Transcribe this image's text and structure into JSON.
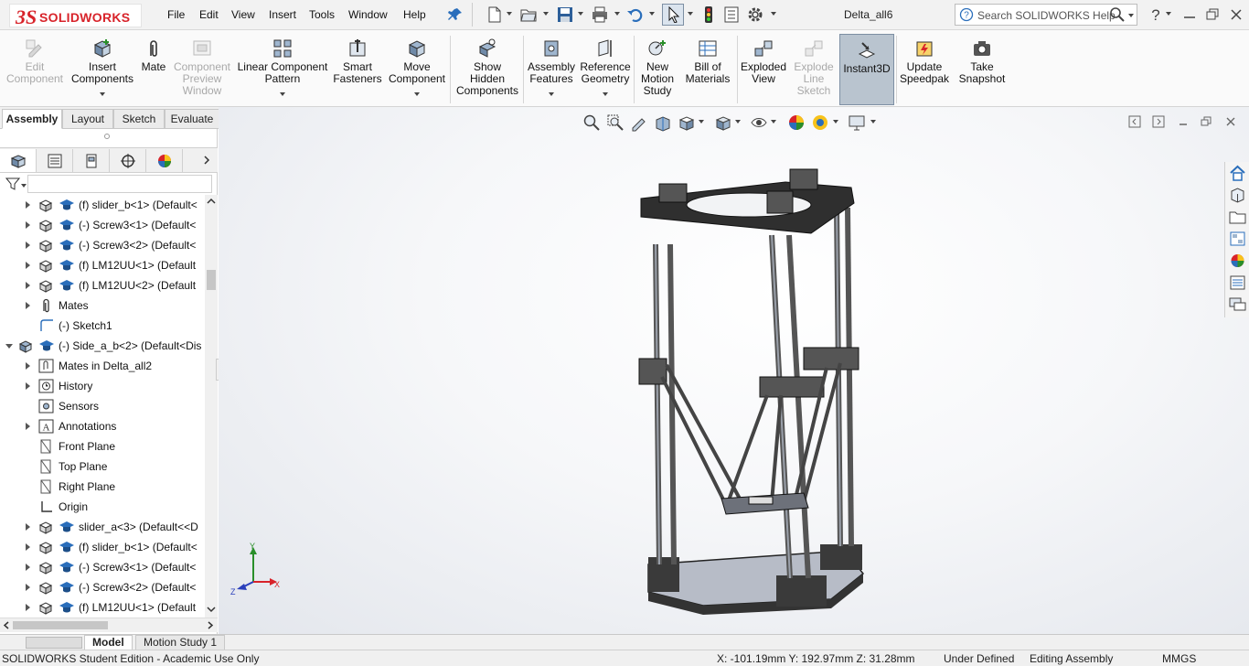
{
  "app": {
    "brand_ds": "3S",
    "brand_name": "SOLIDWORKS",
    "document_title": "Delta_all6"
  },
  "menu": [
    "File",
    "Edit",
    "View",
    "Insert",
    "Tools",
    "Window",
    "Help"
  ],
  "search": {
    "placeholder": "Search SOLIDWORKS Help"
  },
  "commands": [
    {
      "label": "Edit\nComponent",
      "enabled": false,
      "icon": "edit-component-icon"
    },
    {
      "label": "Insert\nComponents",
      "enabled": true,
      "icon": "insert-components-icon"
    },
    {
      "label": "Mate",
      "enabled": true,
      "icon": "mate-icon"
    },
    {
      "label": "Component\nPreview\nWindow",
      "enabled": false,
      "icon": "component-preview-icon"
    },
    {
      "label": "Linear Component\nPattern",
      "enabled": true,
      "icon": "linear-pattern-icon"
    },
    {
      "label": "Smart\nFasteners",
      "enabled": true,
      "icon": "smart-fasteners-icon"
    },
    {
      "label": "Move\nComponent",
      "enabled": true,
      "icon": "move-component-icon"
    },
    {
      "label": "Show\nHidden\nComponents",
      "enabled": true,
      "icon": "show-hidden-icon"
    },
    {
      "label": "Assembly\nFeatures",
      "enabled": true,
      "icon": "assembly-features-icon"
    },
    {
      "label": "Reference\nGeometry",
      "enabled": true,
      "icon": "reference-geometry-icon"
    },
    {
      "label": "New\nMotion\nStudy",
      "enabled": true,
      "icon": "motion-study-icon"
    },
    {
      "label": "Bill of\nMaterials",
      "enabled": true,
      "icon": "bill-of-materials-icon"
    },
    {
      "label": "Exploded\nView",
      "enabled": true,
      "icon": "exploded-view-icon"
    },
    {
      "label": "Explode\nLine\nSketch",
      "enabled": false,
      "icon": "explode-line-icon"
    },
    {
      "label": "Instant3D",
      "enabled": true,
      "icon": "instant3d-icon"
    },
    {
      "label": "Update\nSpeedpak",
      "enabled": true,
      "icon": "speedpak-icon"
    },
    {
      "label": "Take\nSnapshot",
      "enabled": true,
      "icon": "snapshot-icon"
    }
  ],
  "tabs": [
    "Assembly",
    "Layout",
    "Sketch",
    "Evaluate"
  ],
  "tree": [
    {
      "label": "(f) slider_b<1> (Default<",
      "indent": 1,
      "kind": "part"
    },
    {
      "label": "(-) Screw3<1> (Default<",
      "indent": 1,
      "kind": "part"
    },
    {
      "label": "(-) Screw3<2> (Default<",
      "indent": 1,
      "kind": "part"
    },
    {
      "label": "(f) LM12UU<1> (Default",
      "indent": 1,
      "kind": "part"
    },
    {
      "label": "(f) LM12UU<2> (Default",
      "indent": 1,
      "kind": "part"
    },
    {
      "label": "Mates",
      "indent": 1,
      "kind": "mates"
    },
    {
      "label": "(-) Sketch1",
      "indent": 1,
      "kind": "sketch"
    },
    {
      "label": "(-) Side_a_b<2> (Default<Dis",
      "indent": 0,
      "kind": "assembly"
    },
    {
      "label": "Mates in Delta_all2",
      "indent": 1,
      "kind": "mates-in"
    },
    {
      "label": "History",
      "indent": 1,
      "kind": "history"
    },
    {
      "label": "Sensors",
      "indent": 1,
      "kind": "sensors"
    },
    {
      "label": "Annotations",
      "indent": 1,
      "kind": "annotations"
    },
    {
      "label": "Front Plane",
      "indent": 1,
      "kind": "plane"
    },
    {
      "label": "Top Plane",
      "indent": 1,
      "kind": "plane"
    },
    {
      "label": "Right Plane",
      "indent": 1,
      "kind": "plane"
    },
    {
      "label": "Origin",
      "indent": 1,
      "kind": "origin"
    },
    {
      "label": "slider_a<3> (Default<<D",
      "indent": 1,
      "kind": "part"
    },
    {
      "label": "(f) slider_b<1> (Default<",
      "indent": 1,
      "kind": "part"
    },
    {
      "label": "(-) Screw3<1> (Default<",
      "indent": 1,
      "kind": "part"
    },
    {
      "label": "(-) Screw3<2> (Default<",
      "indent": 1,
      "kind": "part"
    },
    {
      "label": "(f) LM12UU<1> (Default",
      "indent": 1,
      "kind": "part"
    }
  ],
  "triad": {
    "x": "X",
    "y": "Y",
    "z": "Z"
  },
  "bottom_tabs": [
    "Model",
    "Motion Study 1"
  ],
  "status": {
    "edition": "SOLIDWORKS Student Edition - Academic Use Only",
    "coords": "X: -101.19mm Y: 192.97mm Z: 31.28mm",
    "definition": "Under Defined",
    "mode": "Editing Assembly",
    "units": "MMGS"
  },
  "colors": {
    "brand": "#d8232a",
    "accent": "#2a6ebb",
    "active_button": "#b9c4cf"
  }
}
